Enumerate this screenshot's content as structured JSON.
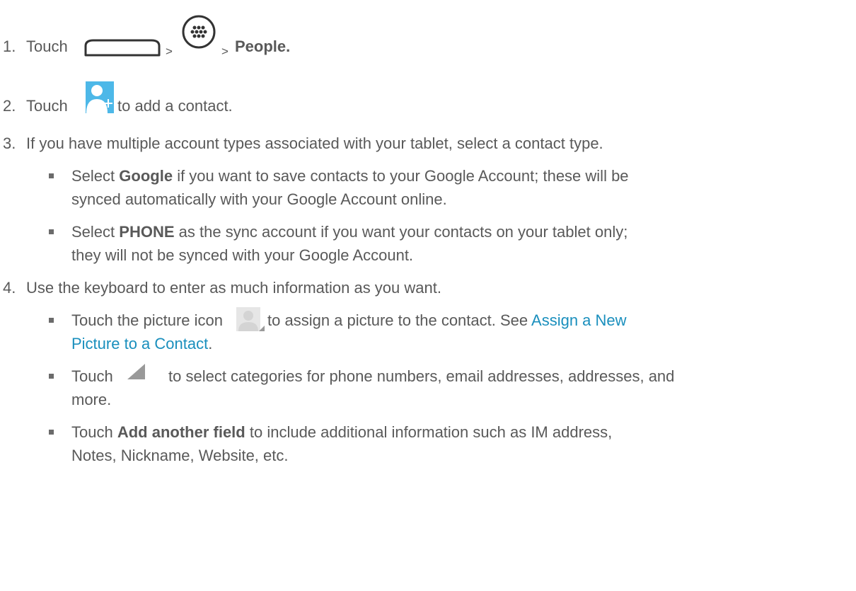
{
  "steps": {
    "s1": {
      "num": "1.",
      "touch": "Touch",
      "sep1": ">",
      "sep2": ">",
      "people": "People."
    },
    "s2": {
      "num": "2.",
      "touch": "Touch",
      "rest": "to add a contact."
    },
    "s3": {
      "num": "3.",
      "text": "If you have multiple account types associated with your tablet, select a contact type."
    },
    "s4": {
      "num": "4.",
      "text": "Use the keyboard to enter as much information as you want."
    }
  },
  "bullets": {
    "google": {
      "pre": "Select",
      "bold": "Google",
      "rest1": "if you want to save contacts to your Google Account; these will be",
      "line2": "synced automatically with your Google Account online."
    },
    "phone": {
      "pre": "Select",
      "bold": "PHONE",
      "rest1": "as the sync account if you want your contacts on your tablet only;",
      "line2": "they will not be synced with your Google Account."
    },
    "picture": {
      "pre": "Touch the picture icon",
      "mid": "to assign a picture to the contact. See",
      "link1": "Assign a New",
      "link2": "Picture to a Contact",
      "end": "."
    },
    "categories": {
      "pre": "Touch",
      "rest1": "to select categories for phone numbers, email addresses, addresses, and",
      "line2": "more."
    },
    "addfield": {
      "pre": "Touch",
      "bold": "Add another field",
      "rest1": "to include additional information such as IM address,",
      "line2": "Notes, Nickname, Website, etc."
    }
  },
  "icons": {
    "home": "home-icon",
    "apps": "apps-icon",
    "add_contact": "add-contact-icon",
    "picture": "contact-picture-icon",
    "category": "category-triangle-icon"
  },
  "colors": {
    "text": "#595959",
    "link": "#1a8fbd",
    "add_contact_blue": "#4db8e8"
  }
}
